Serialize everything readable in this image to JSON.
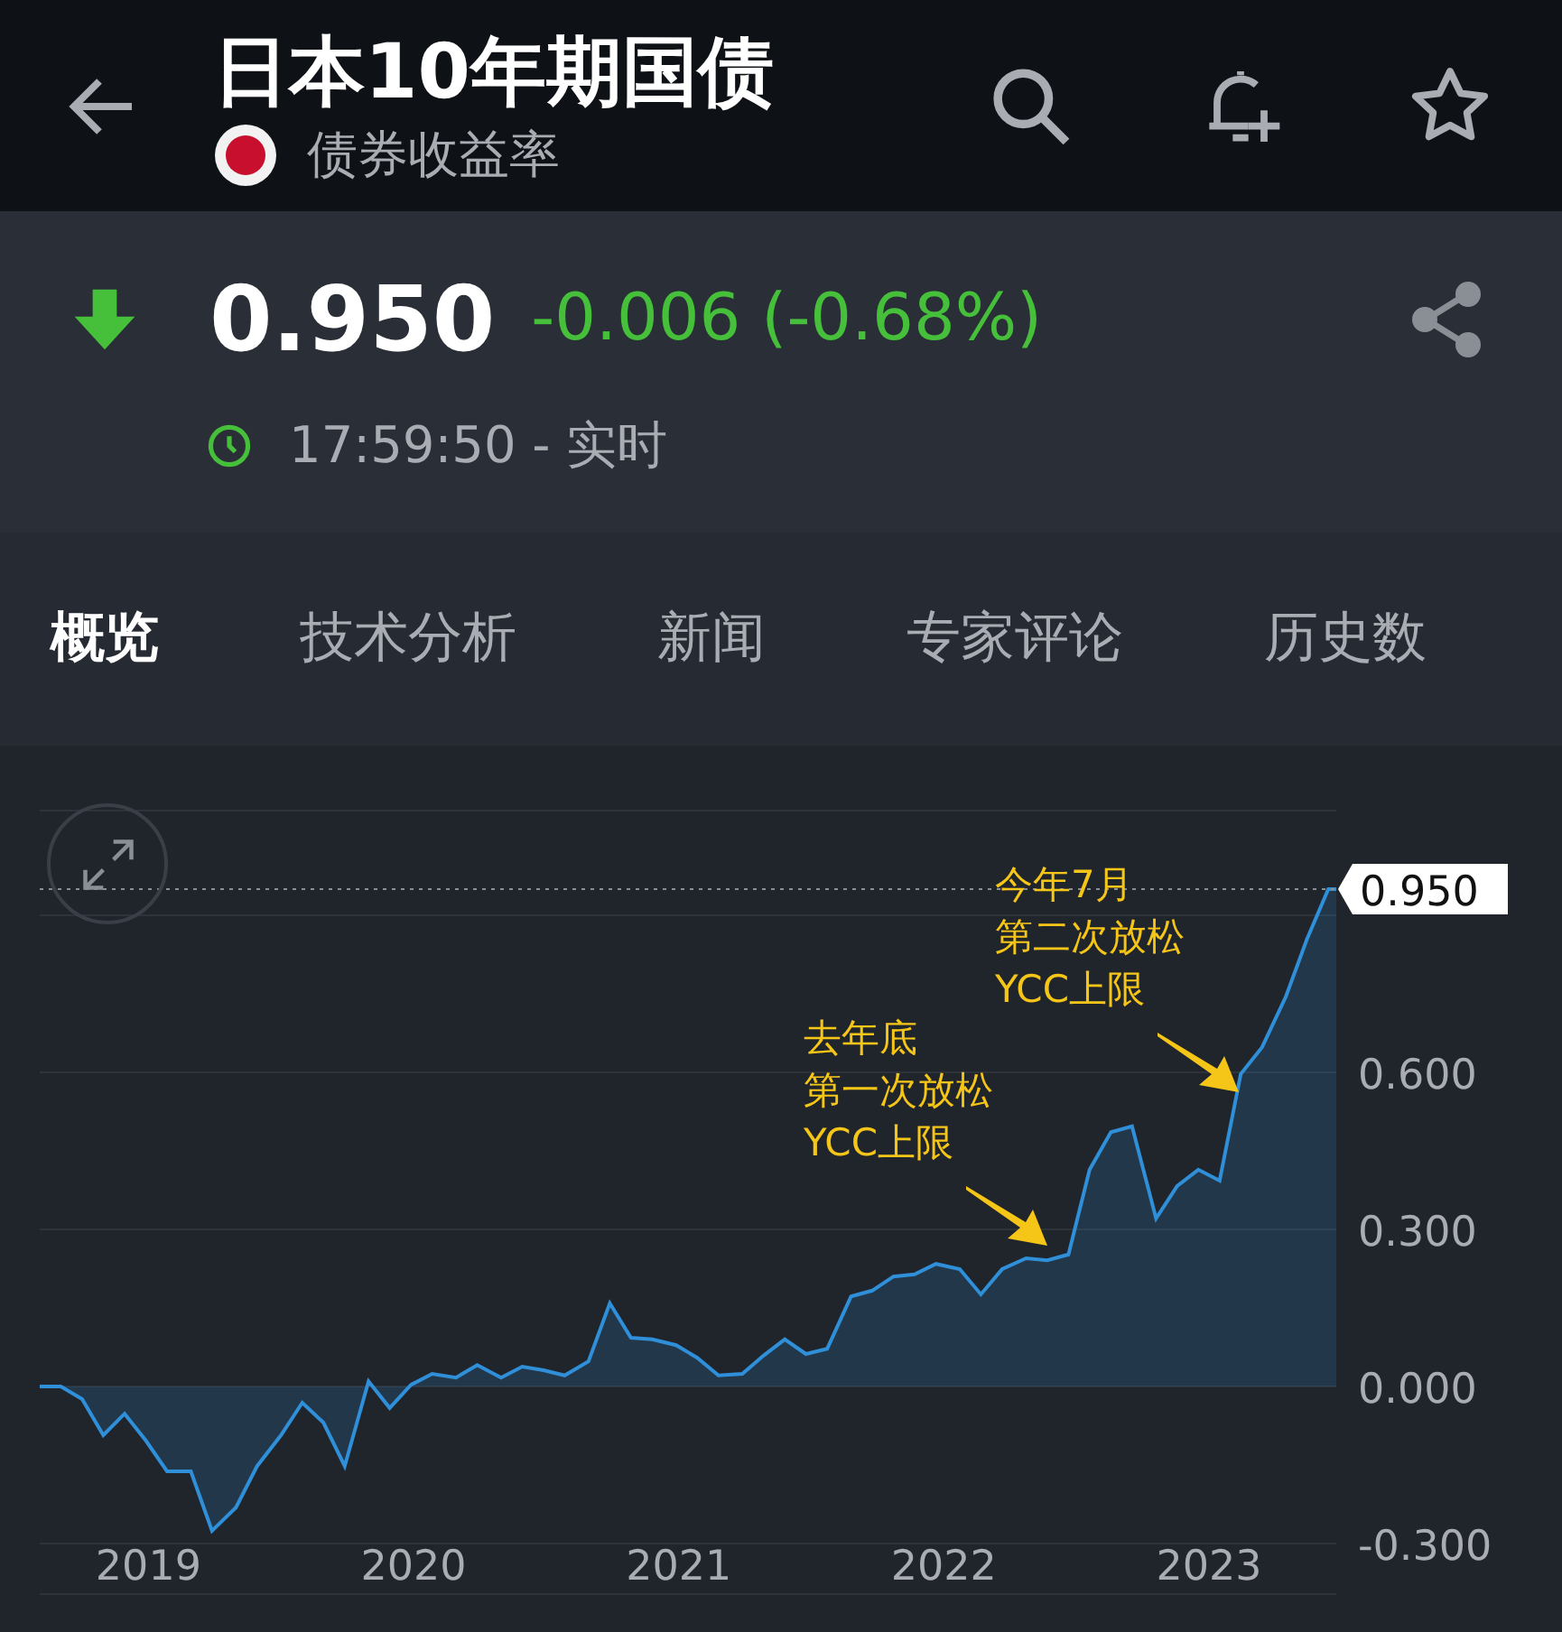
{
  "header": {
    "title": "日本10年期国债",
    "subtitle": "债券收益率"
  },
  "quote": {
    "falling": true,
    "price": "0.950",
    "change": "-0.006 (-0.68%)",
    "time": "17:59:50 - 实时"
  },
  "tabs": [
    {
      "label": "概览",
      "selected": true
    },
    {
      "label": "技术分析",
      "selected": false
    },
    {
      "label": "新闻",
      "selected": false
    },
    {
      "label": "专家评论",
      "selected": false
    },
    {
      "label": "历史数",
      "selected": false
    }
  ],
  "chart": {
    "chart_data": {
      "type": "area",
      "grid": true,
      "ref_lines": [
        {
          "axis": "y",
          "value": 0.95,
          "label": "0.950"
        }
      ],
      "x": [
        2018.59,
        2018.67,
        2018.75,
        2018.83,
        2018.91,
        2018.99,
        2019.07,
        2019.16,
        2019.24,
        2019.33,
        2019.41,
        2019.5,
        2019.58,
        2019.66,
        2019.74,
        2019.83,
        2019.91,
        2019.99,
        2020.07,
        2020.16,
        2020.24,
        2020.33,
        2020.41,
        2020.49,
        2020.57,
        2020.66,
        2020.74,
        2020.82,
        2020.9,
        2020.99,
        2021.07,
        2021.15,
        2021.24,
        2021.32,
        2021.4,
        2021.48,
        2021.56,
        2021.65,
        2021.73,
        2021.81,
        2021.89,
        2021.97,
        2022.06,
        2022.14,
        2022.22,
        2022.31,
        2022.39,
        2022.47,
        2022.55,
        2022.63,
        2022.71,
        2022.8,
        2022.88,
        2022.96,
        2023.04,
        2023.12,
        2023.2,
        2023.29,
        2023.37,
        2023.45,
        2023.48
      ],
      "series": [
        {
          "color": "#2f8fd8",
          "values": [
            0,
            0,
            -0.024,
            -0.093,
            -0.052,
            -0.103,
            -0.162,
            -0.162,
            -0.276,
            -0.231,
            -0.152,
            -0.093,
            -0.031,
            -0.069,
            -0.152,
            0.01,
            -0.041,
            0.003,
            0.024,
            0.017,
            0.041,
            0.017,
            0.038,
            0.031,
            0.021,
            0.048,
            0.159,
            0.093,
            0.09,
            0.079,
            0.055,
            0.021,
            0.024,
            0.059,
            0.09,
            0.062,
            0.072,
            0.172,
            0.183,
            0.21,
            0.214,
            0.234,
            0.224,
            0.176,
            0.224,
            0.245,
            0.241,
            0.252,
            0.414,
            0.486,
            0.497,
            0.321,
            0.383,
            0.414,
            0.393,
            0.597,
            0.648,
            0.745,
            0.855,
            0.95,
            0.95
          ]
        }
      ],
      "xlim": [
        2018.59,
        2023.48
      ],
      "ylim": [
        -0.3,
        1.1
      ],
      "xticks": [
        2019,
        2020,
        2021,
        2022,
        2023
      ],
      "yticks": [
        {
          "value": -0.3,
          "label": "-0.300"
        },
        {
          "value": 0,
          "label": "0.000"
        },
        {
          "value": 0.3,
          "label": "0.300"
        },
        {
          "value": 0.6,
          "label": "0.600"
        }
      ],
      "annotations": [
        {
          "text": "去年底"
        },
        {
          "text": "第一次放松"
        },
        {
          "text": "YCC上限"
        },
        {
          "text": "今年7月"
        },
        {
          "text": "第二次放松"
        },
        {
          "text": "YCC上限"
        }
      ]
    }
  }
}
